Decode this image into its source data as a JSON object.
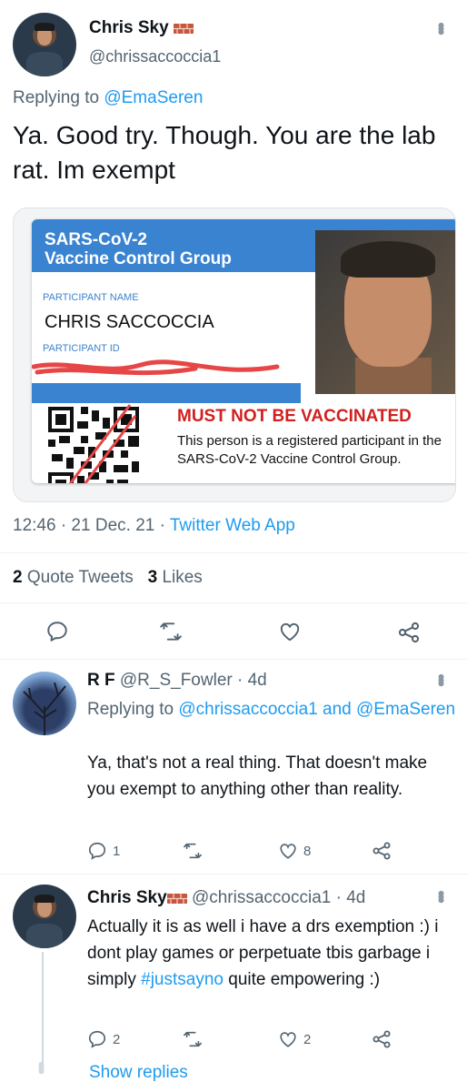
{
  "tweet": {
    "author": "Chris Sky",
    "handle": "@chrissaccoccia1",
    "replying_label": "Replying to",
    "replying_to": "@EmaSeren",
    "text": "Ya. Good try. Though.  You are the lab rat. Im exempt",
    "timestamp": "12:46 · 21 Dec. 21 · ",
    "source": "Twitter Web App",
    "quote_count": "2",
    "quote_label": "Quote Tweets",
    "like_count": "3",
    "like_label": "Likes"
  },
  "card": {
    "title_line1": "SARS-CoV-2",
    "title_line2": "Vaccine Control Group",
    "participant_name_label": "PARTICIPANT NAME",
    "participant_name": "CHRIS SACCOCCIA",
    "participant_id_label": "PARTICIPANT ID",
    "warning": "MUST NOT BE VACCINATED",
    "body": "This person is a registered participant in the SARS-CoV-2 Vaccine Control Group.",
    "colors": {
      "header": "#3a83d1",
      "warning": "#d0201f"
    }
  },
  "replies": [
    {
      "author": "R F",
      "handle": "@R_S_Fowler",
      "age": " · 4d",
      "replying_label": "Replying to",
      "replying_to_1": "@chrissaccoccia1",
      "and": "and",
      "replying_to_2": "@EmaSeren",
      "text": "Ya, that's not a real thing. That doesn't make you exempt to anything other than reality.",
      "reply_count": "1",
      "retweet_count": "",
      "like_count": "8"
    },
    {
      "author": "Chris Sky",
      "handle": "@chrissaccoccia1",
      "age": " · 4d",
      "text_before": "Actually it is as well i have a drs exemption :)  i dont play games or perpetuate tbis garbage i simply ",
      "hashtag": "#justsayno",
      "text_after": "  quite empowering :)",
      "reply_count": "2",
      "retweet_count": "",
      "like_count": "2",
      "show_replies": "Show replies"
    }
  ],
  "icons": [
    "brick-emoji-icon",
    "more-icon",
    "reply-icon",
    "retweet-icon",
    "like-icon",
    "share-icon"
  ],
  "colors": {
    "link": "#1d9bf0",
    "secondary": "#536471",
    "divider": "#eff3f4"
  }
}
